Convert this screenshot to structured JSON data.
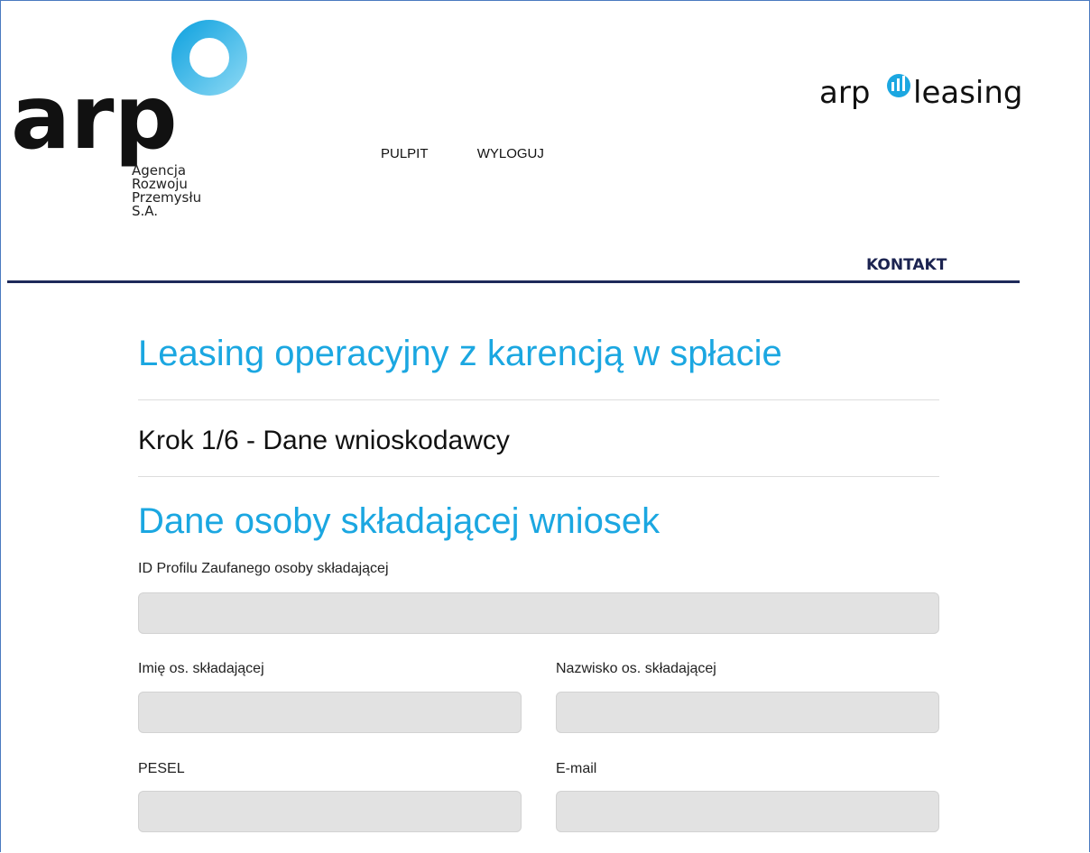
{
  "logo": {
    "arp_wordmark": "arp",
    "subtitle_lines": [
      "Agencja",
      "Rozwoju",
      "Przemysłu",
      "S.A."
    ],
    "right_wordmark_left": "arp",
    "right_wordmark_right": "leasing",
    "brand_blue": "#1ba7e1",
    "brand_dark": "#111111"
  },
  "nav": {
    "items": [
      "PULPIT",
      "WYLOGUJ"
    ],
    "contact": "KONTAKT"
  },
  "page": {
    "title": "Leasing operacyjny z karencją w spłacie",
    "step": "Krok 1/6 - Dane wnioskodawcy",
    "section": "Dane osoby składającej wniosek"
  },
  "form": {
    "profile_id": {
      "label": "ID Profilu Zaufanego osoby składającej",
      "value": ""
    },
    "first_name": {
      "label": "Imię os. składającej",
      "value": ""
    },
    "last_name": {
      "label": "Nazwisko os. składającej",
      "value": ""
    },
    "pesel": {
      "label": "PESEL",
      "value": ""
    },
    "email": {
      "label": "E-mail",
      "value": ""
    }
  }
}
